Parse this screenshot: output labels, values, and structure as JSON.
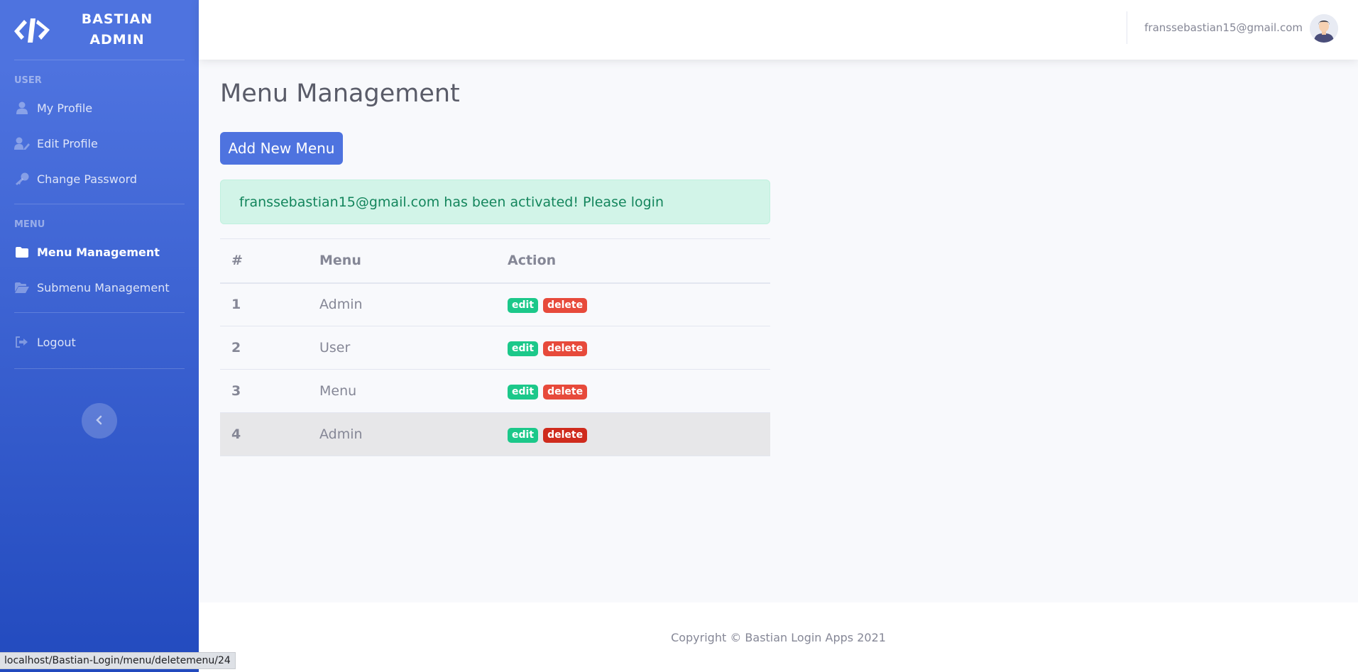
{
  "brand": {
    "line1": "BASTIAN",
    "line2": "ADMIN"
  },
  "sidebar": {
    "section_user": "USER",
    "section_menu": "MENU",
    "items": [
      {
        "label": "My Profile",
        "icon": "user-icon"
      },
      {
        "label": "Edit Profile",
        "icon": "user-edit-icon"
      },
      {
        "label": "Change Password",
        "icon": "key-icon"
      },
      {
        "label": "Menu Management",
        "icon": "folder-icon",
        "active": true
      },
      {
        "label": "Submenu Management",
        "icon": "folder-open-icon"
      },
      {
        "label": "Logout",
        "icon": "sign-out-icon"
      }
    ]
  },
  "topbar": {
    "user_email": "franssebastian15@gmail.com"
  },
  "main": {
    "title": "Menu Management",
    "add_button": "Add New Menu",
    "alert": "franssebastian15@gmail.com has been activated! Please login",
    "table": {
      "headers": [
        "#",
        "Menu",
        "Action"
      ],
      "rows": [
        {
          "num": "1",
          "menu": "Admin"
        },
        {
          "num": "2",
          "menu": "User"
        },
        {
          "num": "3",
          "menu": "Menu"
        },
        {
          "num": "4",
          "menu": "Admin"
        }
      ],
      "edit_label": "edit",
      "delete_label": "delete"
    }
  },
  "footer": {
    "copyright": "Copyright © Bastian Login Apps 2021"
  },
  "status_url": "localhost/Bastian-Login/menu/deletemenu/24",
  "colors": {
    "primary": "#4e73df",
    "success": "#1cc88a",
    "danger": "#e74a3b",
    "alert_bg": "#d2f4e8"
  }
}
